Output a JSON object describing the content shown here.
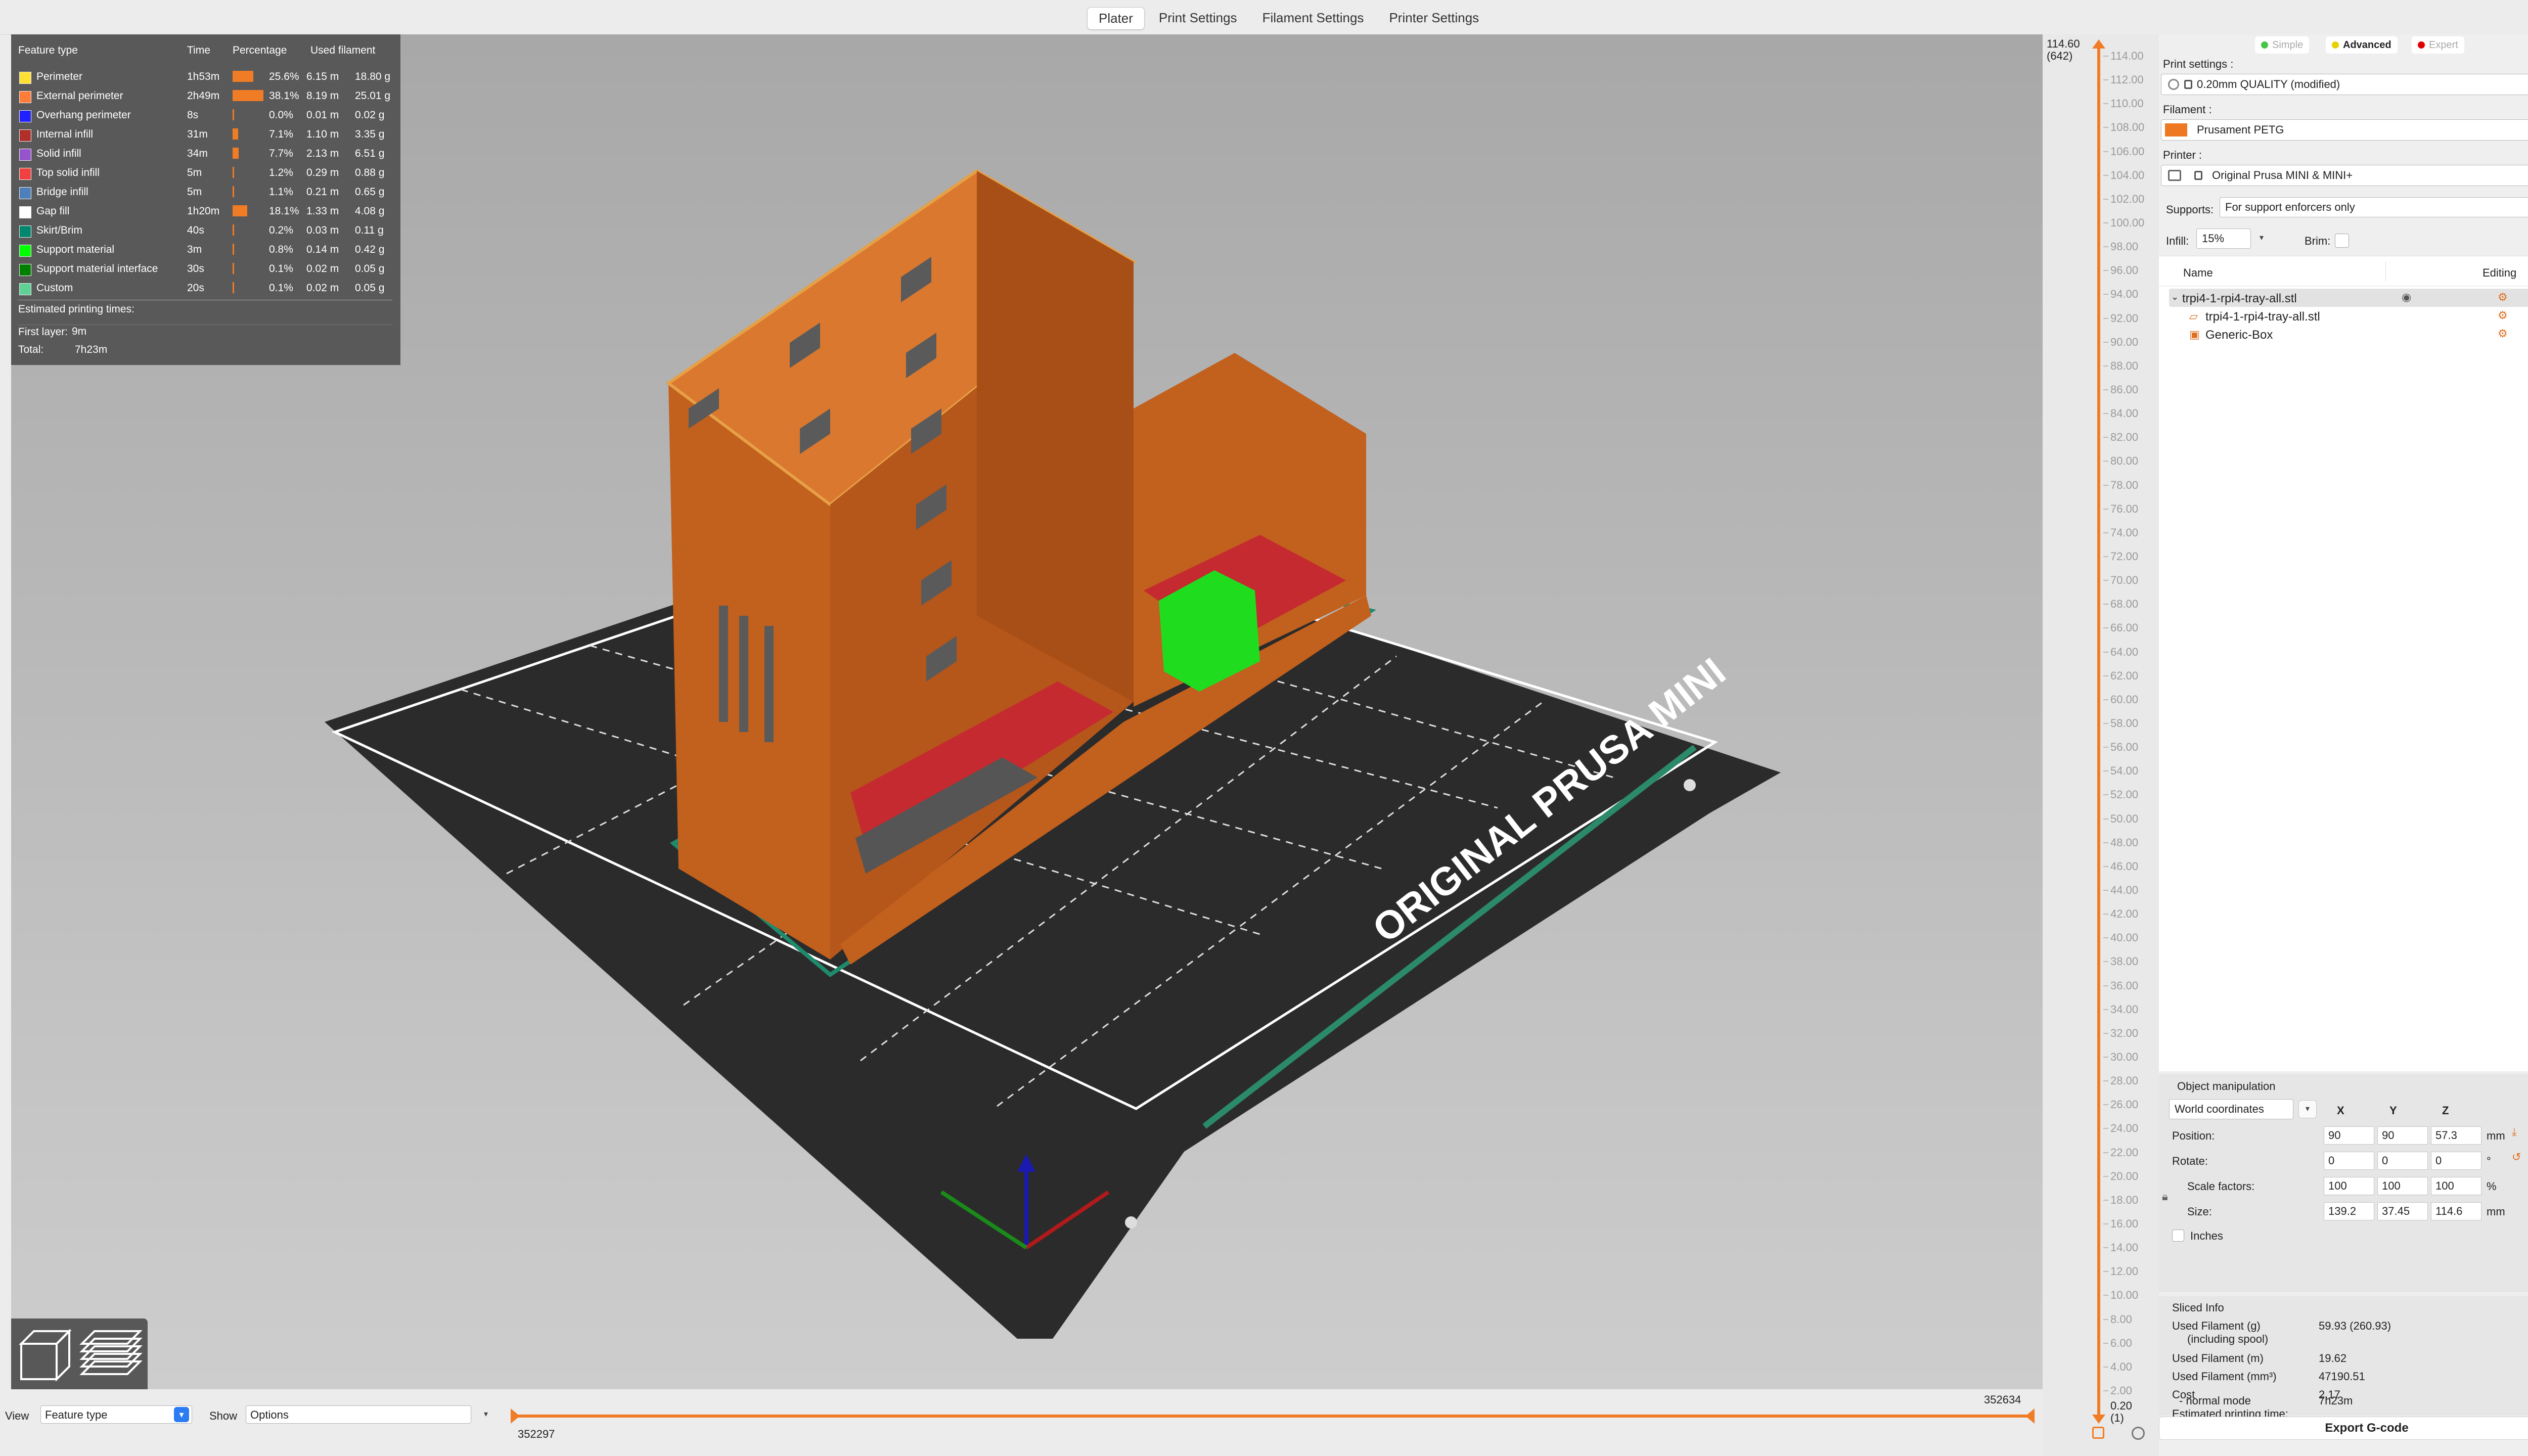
{
  "tabs": [
    "Plater",
    "Print Settings",
    "Filament Settings",
    "Printer Settings"
  ],
  "legend": {
    "headers": {
      "feature": "Feature type",
      "time": "Time",
      "percentage": "Percentage",
      "filament": "Used filament"
    },
    "rows": [
      {
        "name": "Perimeter",
        "time": "1h53m",
        "pct": "25.6%",
        "pct_value": 25.6,
        "length": "6.15 m",
        "weight": "18.80 g",
        "color": "#ffe033"
      },
      {
        "name": "External perimeter",
        "time": "2h49m",
        "pct": "38.1%",
        "pct_value": 38.1,
        "length": "8.19 m",
        "weight": "25.01 g",
        "color": "#ff7d38"
      },
      {
        "name": "Overhang perimeter",
        "time": "8s",
        "pct": "0.0%",
        "pct_value": 0.0,
        "length": "0.01 m",
        "weight": "0.02 g",
        "color": "#1f1fff"
      },
      {
        "name": "Internal infill",
        "time": "31m",
        "pct": "7.1%",
        "pct_value": 7.1,
        "length": "1.10 m",
        "weight": "3.35 g",
        "color": "#b03029"
      },
      {
        "name": "Solid infill",
        "time": "34m",
        "pct": "7.7%",
        "pct_value": 7.7,
        "length": "2.13 m",
        "weight": "6.51 g",
        "color": "#9654cc"
      },
      {
        "name": "Top solid infill",
        "time": "5m",
        "pct": "1.2%",
        "pct_value": 1.2,
        "length": "0.29 m",
        "weight": "0.88 g",
        "color": "#f04040"
      },
      {
        "name": "Bridge infill",
        "time": "5m",
        "pct": "1.1%",
        "pct_value": 1.1,
        "length": "0.21 m",
        "weight": "0.65 g",
        "color": "#4d80ba"
      },
      {
        "name": "Gap fill",
        "time": "1h20m",
        "pct": "18.1%",
        "pct_value": 18.1,
        "length": "1.33 m",
        "weight": "4.08 g",
        "color": "#ffffff"
      },
      {
        "name": "Skirt/Brim",
        "time": "40s",
        "pct": "0.2%",
        "pct_value": 0.2,
        "length": "0.03 m",
        "weight": "0.11 g",
        "color": "#00876e"
      },
      {
        "name": "Support material",
        "time": "3m",
        "pct": "0.8%",
        "pct_value": 0.8,
        "length": "0.14 m",
        "weight": "0.42 g",
        "color": "#00ff00"
      },
      {
        "name": "Support material interface",
        "time": "30s",
        "pct": "0.1%",
        "pct_value": 0.1,
        "length": "0.02 m",
        "weight": "0.05 g",
        "color": "#008000"
      },
      {
        "name": "Custom",
        "time": "20s",
        "pct": "0.1%",
        "pct_value": 0.1,
        "length": "0.02 m",
        "weight": "0.05 g",
        "color": "#5ed194"
      }
    ],
    "est_title": "Estimated printing times:",
    "first_layer_label": "First layer:",
    "first_layer_value": "9m",
    "total_label": "Total:",
    "total_value": "7h23m"
  },
  "bed_label": "ORIGINAL PRUSA MINI",
  "bottom": {
    "view_label": "View",
    "view_value": "Feature type",
    "show_label": "Show",
    "show_value": "Options",
    "hslider_start": "352297",
    "hslider_end": "352634"
  },
  "vslider": {
    "top_value": "114.60",
    "top_layer": "(642)",
    "bottom_value": "0.20",
    "bottom_layer": "(1)",
    "ticks": [
      "114.00",
      "112.00",
      "110.00",
      "108.00",
      "106.00",
      "104.00",
      "102.00",
      "100.00",
      "98.00",
      "96.00",
      "94.00",
      "92.00",
      "90.00",
      "88.00",
      "86.00",
      "84.00",
      "82.00",
      "80.00",
      "78.00",
      "76.00",
      "74.00",
      "72.00",
      "70.00",
      "68.00",
      "66.00",
      "64.00",
      "62.00",
      "60.00",
      "58.00",
      "56.00",
      "54.00",
      "52.00",
      "50.00",
      "48.00",
      "46.00",
      "44.00",
      "42.00",
      "40.00",
      "38.00",
      "36.00",
      "34.00",
      "32.00",
      "30.00",
      "28.00",
      "26.00",
      "24.00",
      "22.00",
      "20.00",
      "18.00",
      "16.00",
      "14.00",
      "12.00",
      "10.00",
      "8.00",
      "6.00",
      "4.00",
      "2.00"
    ]
  },
  "panel": {
    "modes": {
      "simple": "Simple",
      "advanced": "Advanced",
      "expert": "Expert"
    },
    "mode_colors": {
      "simple": "#45c645",
      "advanced": "#e8d000",
      "expert": "#e00000"
    },
    "print_settings_label": "Print settings :",
    "print_settings_value": "0.20mm QUALITY (modified)",
    "filament_label": "Filament :",
    "filament_value": "Prusament PETG",
    "filament_color": "#ee7722",
    "printer_label": "Printer :",
    "printer_value": "Original Prusa MINI & MINI+",
    "supports_label": "Supports:",
    "supports_value": "For support enforcers only",
    "infill_label": "Infill:",
    "infill_value": "15%",
    "brim_label": "Brim:",
    "list_headers": {
      "name": "Name",
      "editing": "Editing"
    },
    "objects": [
      {
        "name": "trpi4-1-rpi4-tray-all.stl",
        "level": 0
      },
      {
        "name": "trpi4-1-rpi4-tray-all.stl",
        "level": 1
      },
      {
        "name": "Generic-Box",
        "level": 1
      }
    ],
    "manip": {
      "title": "Object manipulation",
      "coord_value": "World coordinates",
      "axes": [
        "X",
        "Y",
        "Z"
      ],
      "position_label": "Position:",
      "position": [
        "90",
        "90",
        "57.3"
      ],
      "position_unit": "mm",
      "rotate_label": "Rotate:",
      "rotate": [
        "0",
        "0",
        "0"
      ],
      "rotate_unit": "°",
      "scale_label": "Scale factors:",
      "scale": [
        "100",
        "100",
        "100"
      ],
      "scale_unit": "%",
      "size_label": "Size:",
      "size": [
        "139.2",
        "37.45",
        "114.6"
      ],
      "size_unit": "mm",
      "inches_label": "Inches"
    },
    "sliced": {
      "title": "Sliced Info",
      "filament_g_label": "Used Filament (g)",
      "filament_g_sub": "(including spool)",
      "filament_g_value": "59.93 (260.93)",
      "filament_m_label": "Used Filament (m)",
      "filament_m_value": "19.62",
      "filament_mm3_label": "Used Filament (mm³)",
      "filament_mm3_value": "47190.51",
      "cost_label": "Cost",
      "cost_value": "2.17",
      "time_label": "Estimated printing time:",
      "time_sub": "- normal mode",
      "time_value": "7h23m"
    },
    "export_label": "Export G-code"
  }
}
